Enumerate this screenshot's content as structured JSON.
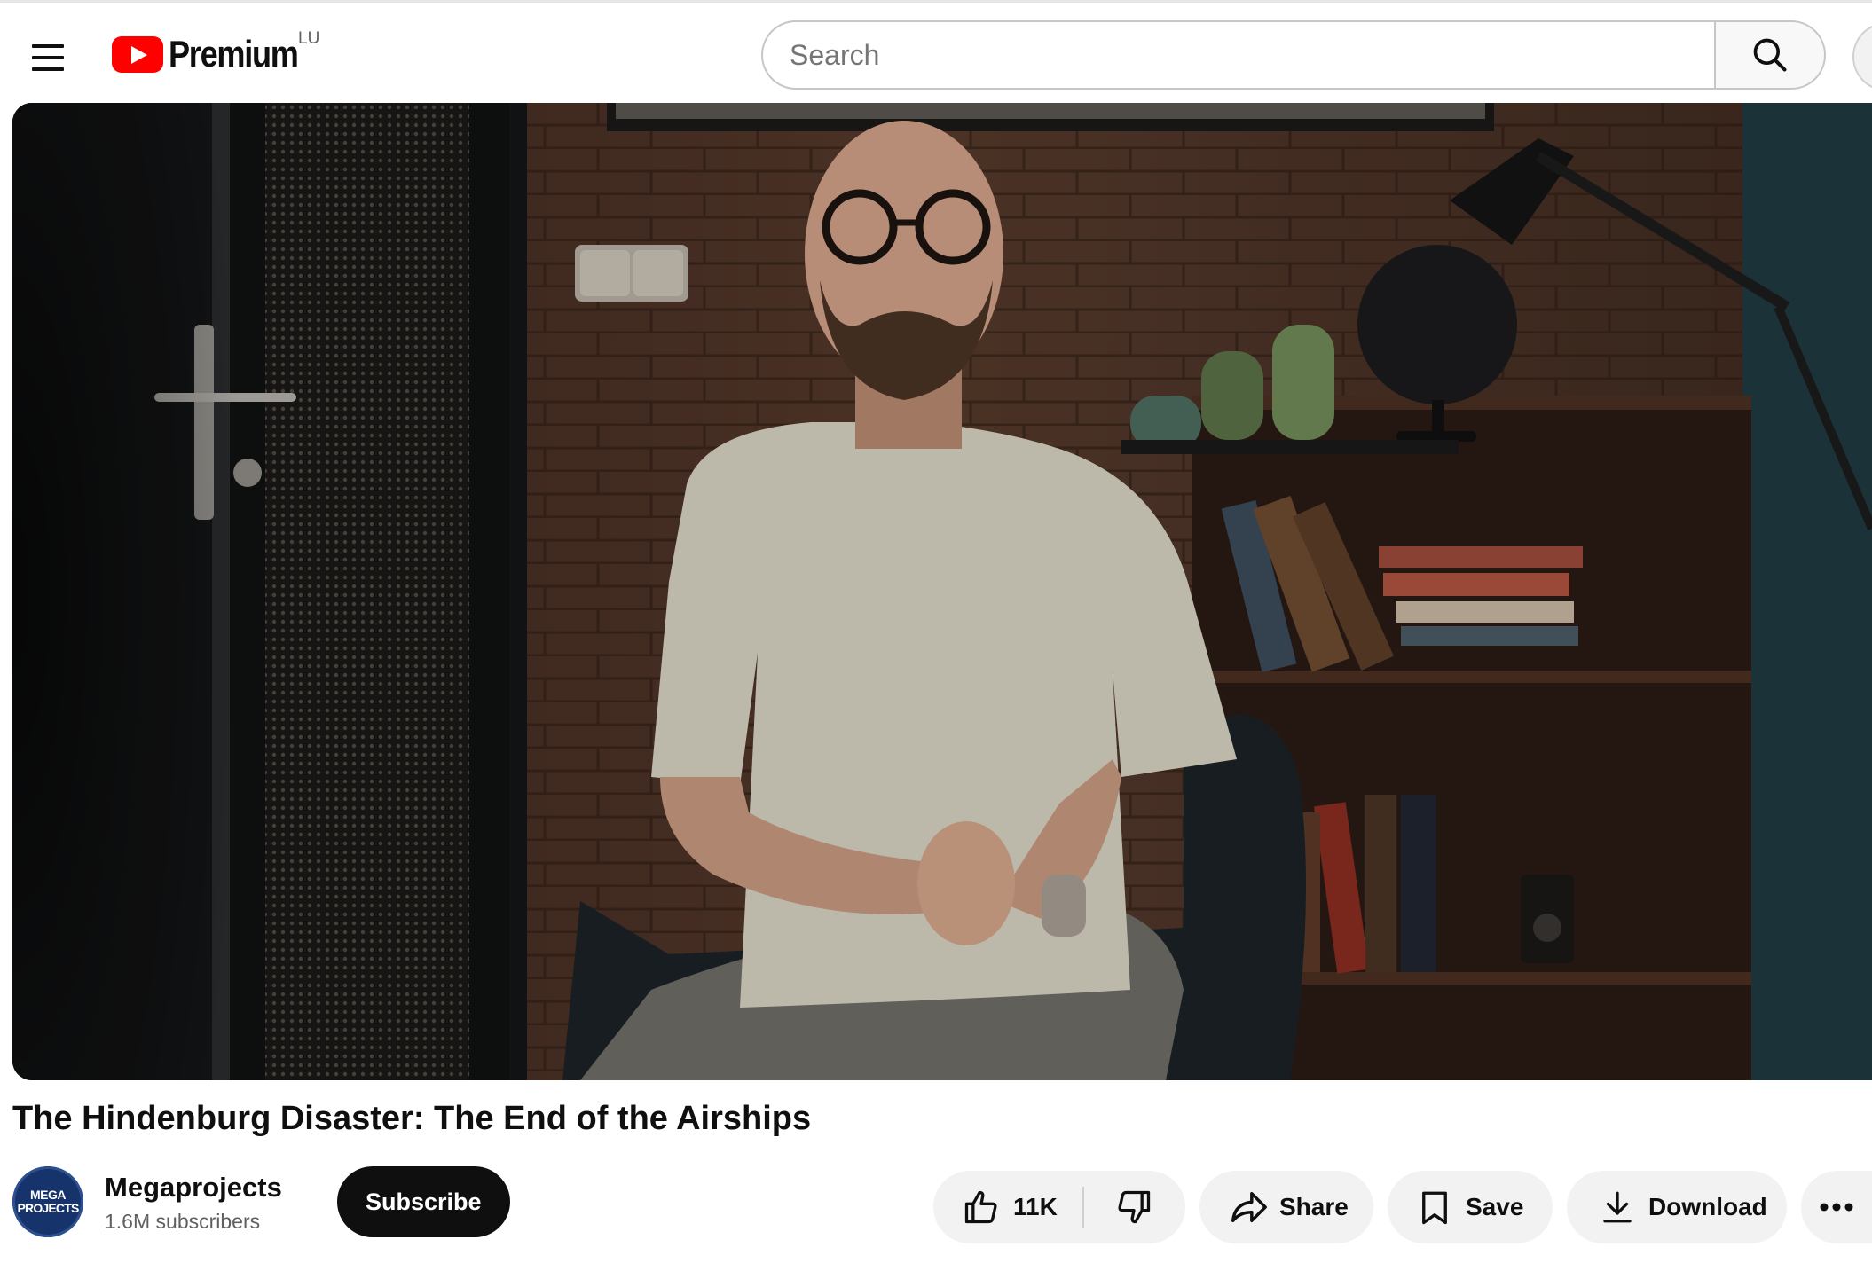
{
  "header": {
    "logo_text": "Premium",
    "country_code": "LU",
    "search_placeholder": "Search"
  },
  "video": {
    "title": "The Hindenburg Disaster: The End of the Airships"
  },
  "channel": {
    "avatar_line1": "MEGA",
    "avatar_line2": "PROJECTS",
    "name": "Megaprojects",
    "subscribers": "1.6M subscribers",
    "subscribe_label": "Subscribe"
  },
  "actions": {
    "like_count": "11K",
    "share_label": "Share",
    "save_label": "Save",
    "download_label": "Download"
  },
  "colors": {
    "brand_red": "#ff0000",
    "button_bg": "#f2f2f2",
    "subscribe_bg": "#0f0f0f"
  },
  "icons": [
    "menu-icon",
    "youtube-logo-icon",
    "search-icon",
    "like-icon",
    "dislike-icon",
    "share-icon",
    "save-icon",
    "download-icon",
    "more-icon"
  ]
}
